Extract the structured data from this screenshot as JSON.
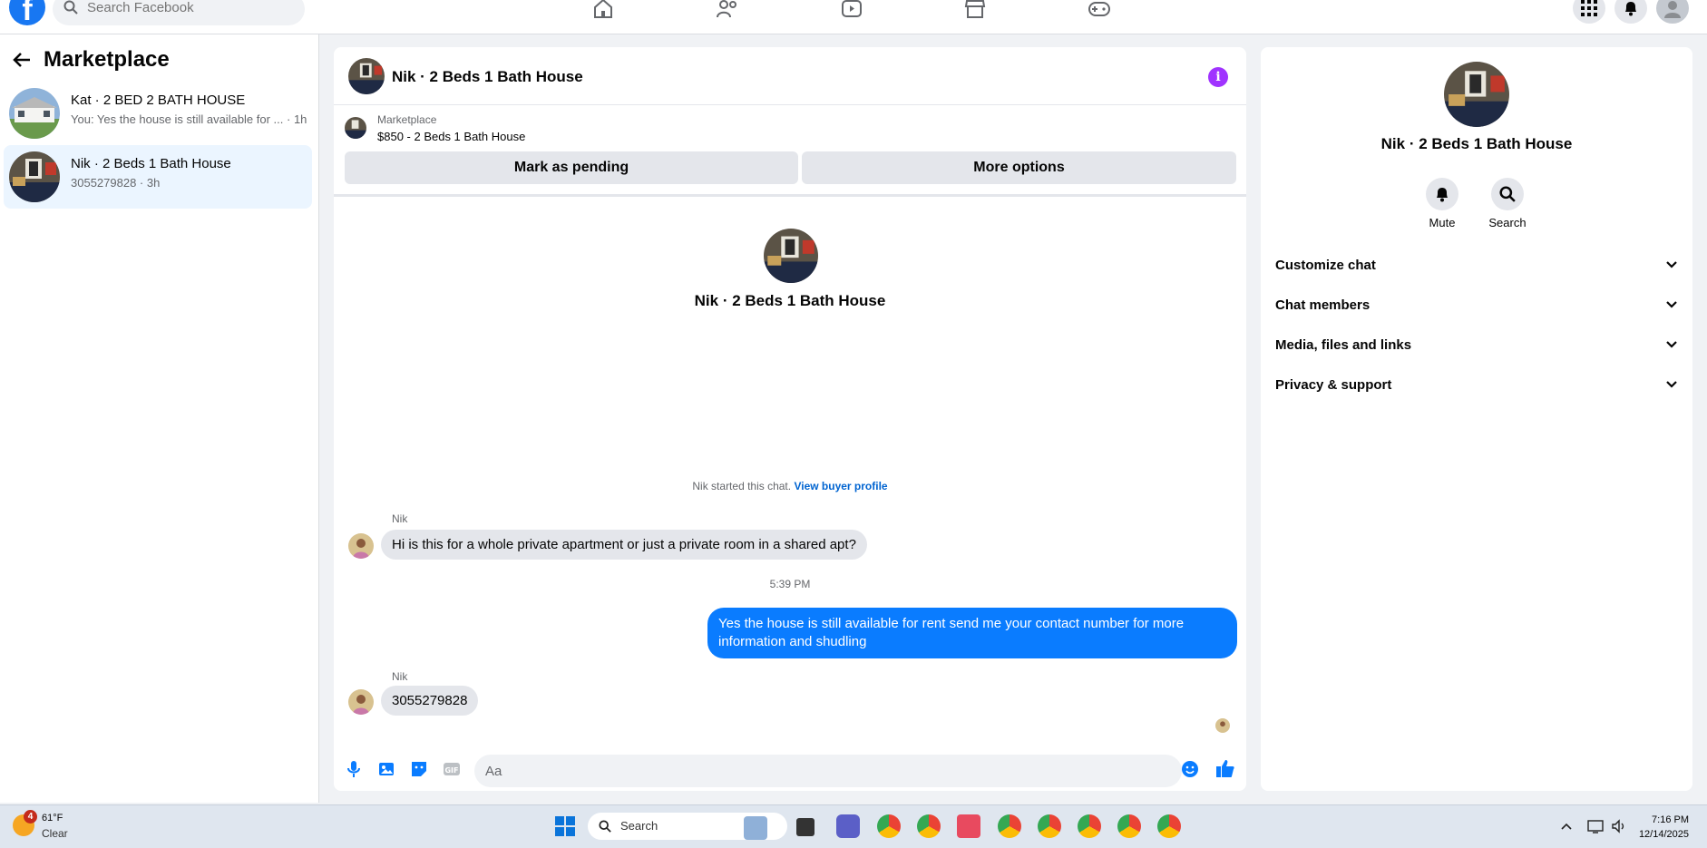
{
  "topbar": {
    "logo": "f",
    "search_placeholder": "Search Facebook",
    "nav_icons": [
      "home-icon",
      "friends-icon",
      "watch-icon",
      "marketplace-icon",
      "gaming-icon"
    ]
  },
  "left_panel": {
    "title": "Marketplace",
    "conversations": [
      {
        "title": "Kat · 2 BED 2 BATH HOUSE",
        "subtitle": "You: Yes the house is still available for ... · 1h"
      },
      {
        "title": "Nik · 2 Beds 1 Bath House",
        "subtitle": "3055279828 · 3h"
      }
    ]
  },
  "chat": {
    "title": "Nik · 2 Beds 1 Bath House",
    "marketplace_label": "Marketplace",
    "listing": "$850 - 2 Beds 1 Bath House",
    "mark_pending_label": "Mark as pending",
    "more_options_label": "More options",
    "intro_title": "Nik · 2 Beds 1 Bath House",
    "started_text": "Nik started this chat.",
    "view_profile_label": "View buyer profile",
    "messages": [
      {
        "sender": "Nik",
        "text": "Hi is this for a whole private apartment or just a private room in a shared apt?"
      },
      {
        "time": "5:39 PM"
      },
      {
        "text": "Yes the house is still available for rent send me your contact number for more information and shudling"
      },
      {
        "sender": "Nik",
        "text": "3055279828"
      }
    ],
    "composer_placeholder": "Aa",
    "accent_color": "#0a7cff"
  },
  "right_panel": {
    "title": "Nik · 2 Beds 1 Bath House",
    "actions": [
      {
        "label": "Mute",
        "icon": "bell-icon"
      },
      {
        "label": "Search",
        "icon": "search-icon"
      }
    ],
    "sections": [
      "Customize chat",
      "Chat members",
      "Media, files and links",
      "Privacy & support"
    ]
  },
  "taskbar": {
    "weather_badge": "4",
    "temp": "61°F",
    "condition": "Clear",
    "search_label": "Search",
    "time": "7:16 PM",
    "date": "12/14/2025"
  }
}
